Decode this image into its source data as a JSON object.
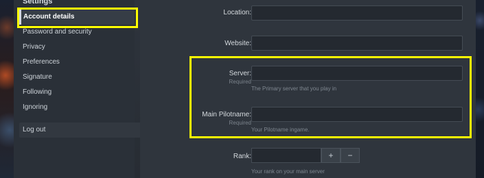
{
  "sidebar": {
    "title": "Settings",
    "items": [
      {
        "label": "Account details",
        "active": true
      },
      {
        "label": "Password and security"
      },
      {
        "label": "Privacy"
      },
      {
        "label": "Preferences"
      },
      {
        "label": "Signature"
      },
      {
        "label": "Following"
      },
      {
        "label": "Ignoring"
      }
    ],
    "logout_label": "Log out"
  },
  "form": {
    "location": {
      "label": "Location:",
      "value": ""
    },
    "website": {
      "label": "Website:",
      "value": ""
    },
    "server": {
      "label": "Server:",
      "required": "Required",
      "value": "",
      "hint": "The Primary server that you play in"
    },
    "pilotname": {
      "label": "Main Pilotname:",
      "required": "Required",
      "value": "",
      "hint": "Your Pilotname ingame."
    },
    "rank": {
      "label": "Rank:",
      "value": "",
      "plus": "+",
      "minus": "−",
      "hint": "Your rank on your main server"
    }
  },
  "colors": {
    "highlight": "#ffff00",
    "panel": "#2f353d",
    "sidebar": "#2a3038"
  }
}
